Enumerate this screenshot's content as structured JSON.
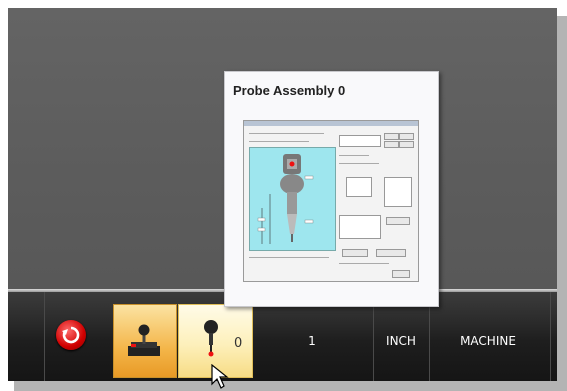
{
  "popup": {
    "title": "Probe Assembly 0"
  },
  "status_bar": {
    "probe_value": "0",
    "field_value": "1",
    "units": "INCH",
    "coordinate_mode": "MACHINE"
  },
  "icons": {
    "reset": "reset-icon",
    "jog": "joystick-icon",
    "probe": "probe-icon",
    "cursor": "mouse-pointer-icon"
  },
  "colors": {
    "reset_red": "#d00000",
    "jog_active": "#f4b64a",
    "probe_active": "#fdf0bb",
    "preview_cyan": "#9ee6ee"
  }
}
